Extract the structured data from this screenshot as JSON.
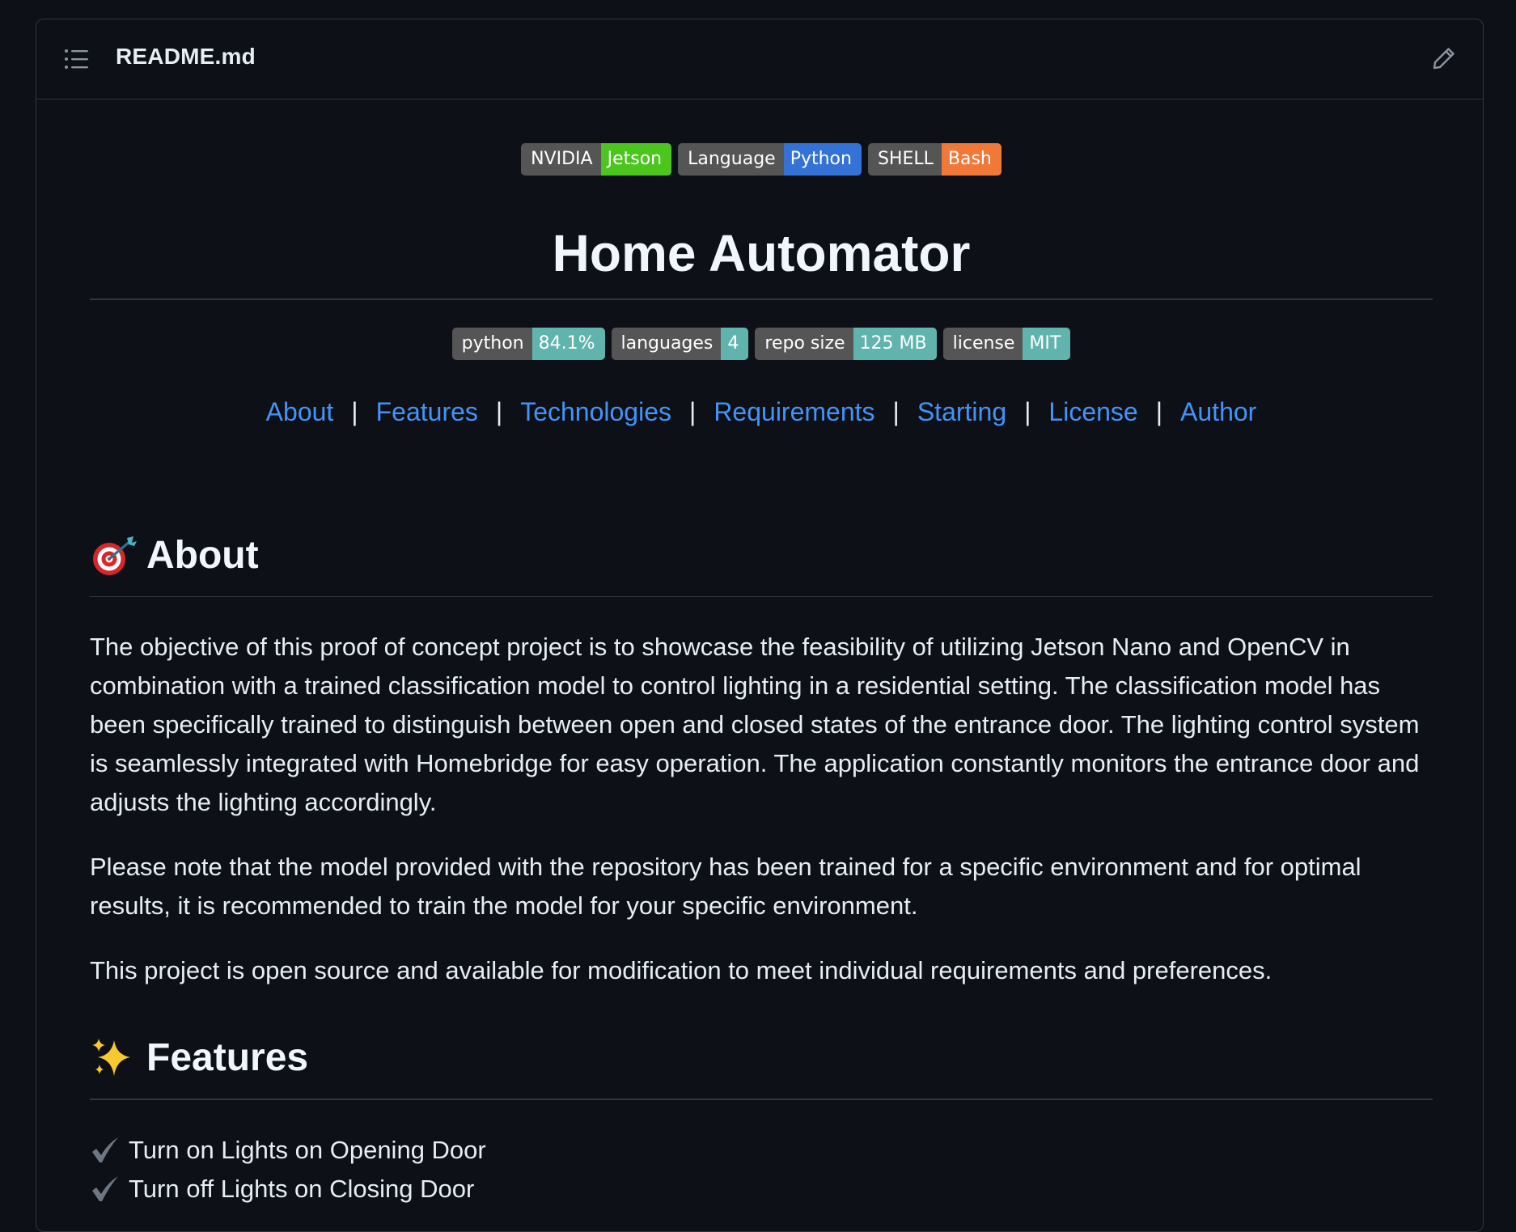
{
  "header": {
    "file_name": "README.md",
    "toc_icon": "list-unordered-icon",
    "edit_icon": "pencil-icon"
  },
  "badges_top": [
    {
      "label": "NVIDIA",
      "value": "Jetson",
      "color": "#4cc61e"
    },
    {
      "label": "Language",
      "value": "Python",
      "color": "#3572d6"
    },
    {
      "label": "SHELL",
      "value": "Bash",
      "color": "#f0793a"
    }
  ],
  "title": "Home Automator",
  "badges_stats": [
    {
      "label": "python",
      "value": "84.1%",
      "color": "#60b4ad"
    },
    {
      "label": "languages",
      "value": "4",
      "color": "#60b4ad"
    },
    {
      "label": "repo size",
      "value": "125 MB",
      "color": "#60b4ad"
    },
    {
      "label": "license",
      "value": "MIT",
      "color": "#60b4ad"
    }
  ],
  "nav": {
    "links": [
      "About",
      "Features",
      "Technologies",
      "Requirements",
      "Starting",
      "License",
      "Author"
    ],
    "separator": "|"
  },
  "about": {
    "heading": "About",
    "icon": "dart-target-emoji-icon",
    "paragraphs": [
      "The objective of this proof of concept project is to showcase the feasibility of utilizing Jetson Nano and OpenCV in combination with a trained classification model to control lighting in a residential setting. The classification model has been specifically trained to distinguish between open and closed states of the entrance door. The lighting control system is seamlessly integrated with Homebridge for easy operation. The application constantly monitors the entrance door and adjusts the lighting accordingly.",
      "Please note that the model provided with the repository has been trained for a specific environment and for optimal results, it is recommended to train the model for your specific environment.",
      "This project is open source and available for modification to meet individual requirements and preferences."
    ]
  },
  "features": {
    "heading": "Features",
    "icon": "sparkles-emoji-icon",
    "items": [
      "Turn on Lights on Opening Door",
      "Turn off Lights on Closing Door"
    ],
    "check_icon": "check-mark-icon"
  }
}
